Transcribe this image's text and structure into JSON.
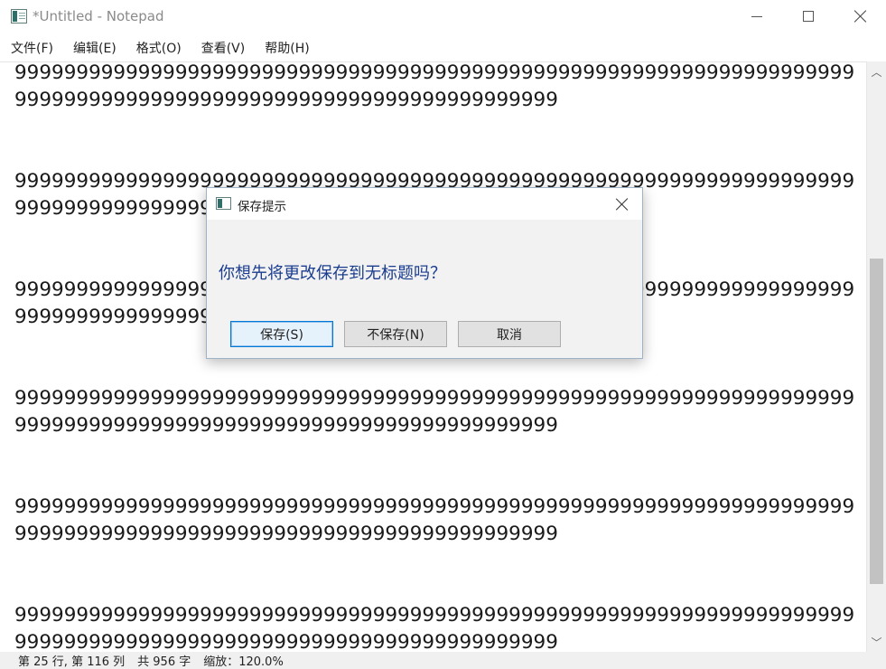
{
  "window": {
    "title": "*Untitled - Notepad",
    "icon": "notepad-icon"
  },
  "menu": {
    "items": [
      {
        "label": "文件(F)"
      },
      {
        "label": "编辑(E)"
      },
      {
        "label": "格式(O)"
      },
      {
        "label": "查看(V)"
      },
      {
        "label": "帮助(H)"
      }
    ]
  },
  "editor": {
    "content": "9999999999999999999999999999999999999999999999999999999999999999999999999999999999999999999999999999999999999999\n\n\n9999999999999999999999999999999999999999999999999999999999999999999999999999999999999999999999999999999999999999\n\n\n9999999999999999999999999999999999999999999999999999999999999999999999999999999999999999999999999999999999999999\n\n\n9999999999999999999999999999999999999999999999999999999999999999999999999999999999999999999999999999999999999999\n\n\n9999999999999999999999999999999999999999999999999999999999999999999999999999999999999999999999999999999999999999\n\n\n9999999999999999999999999999999999999999999999999999999999999999999999999999999999999999999999999999999999999999"
  },
  "statusbar": {
    "position": "第 25 行, 第 116 列",
    "count": "共 956 字",
    "zoom": "缩放：120.0%"
  },
  "dialog": {
    "title": "保存提示",
    "message": "你想先将更改保存到无标题吗？",
    "save_label": "保存(S)",
    "nosave_label": "不保存(N)",
    "cancel_label": "取消"
  },
  "colors": {
    "accent": "#0078d7",
    "message": "#1a3d8f"
  }
}
